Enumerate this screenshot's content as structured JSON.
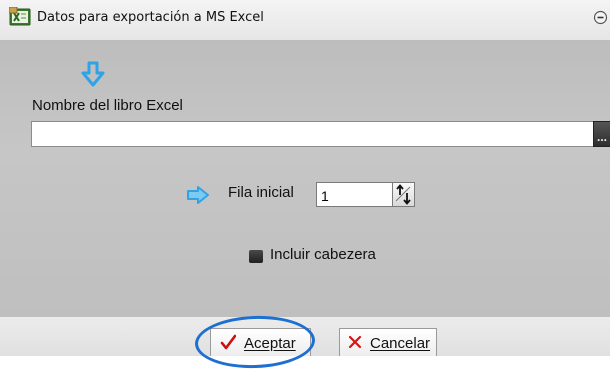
{
  "window": {
    "title": "Datos para exportación a MS Excel",
    "app_icon": "excel-app-icon",
    "collapse_icon": "collapse-circle-icon"
  },
  "form": {
    "book_label": "Nombre del libro Excel",
    "book_value": "",
    "browse_label": "...",
    "row_label": "Fila inicial",
    "row_value": "1",
    "include_header_label": "Incluir cabezera",
    "include_header_checked": false
  },
  "buttons": {
    "ok_label": "Aceptar",
    "ok_icon": "checkmark-icon",
    "cancel_label": "Cancelar",
    "cancel_icon": "cross-icon"
  },
  "annotations": {
    "arrow_down_icon": "arrow-down-icon",
    "arrow_right_icon": "arrow-right-icon",
    "highlight": "circle-around-accept-button"
  },
  "colors": {
    "panel_bg": "#c2c2c2",
    "annotation_blue": "#2fa3e6",
    "highlight_blue": "#1d6fd1",
    "ok_check": "#cc1111",
    "cancel_x": "#dd1111"
  }
}
